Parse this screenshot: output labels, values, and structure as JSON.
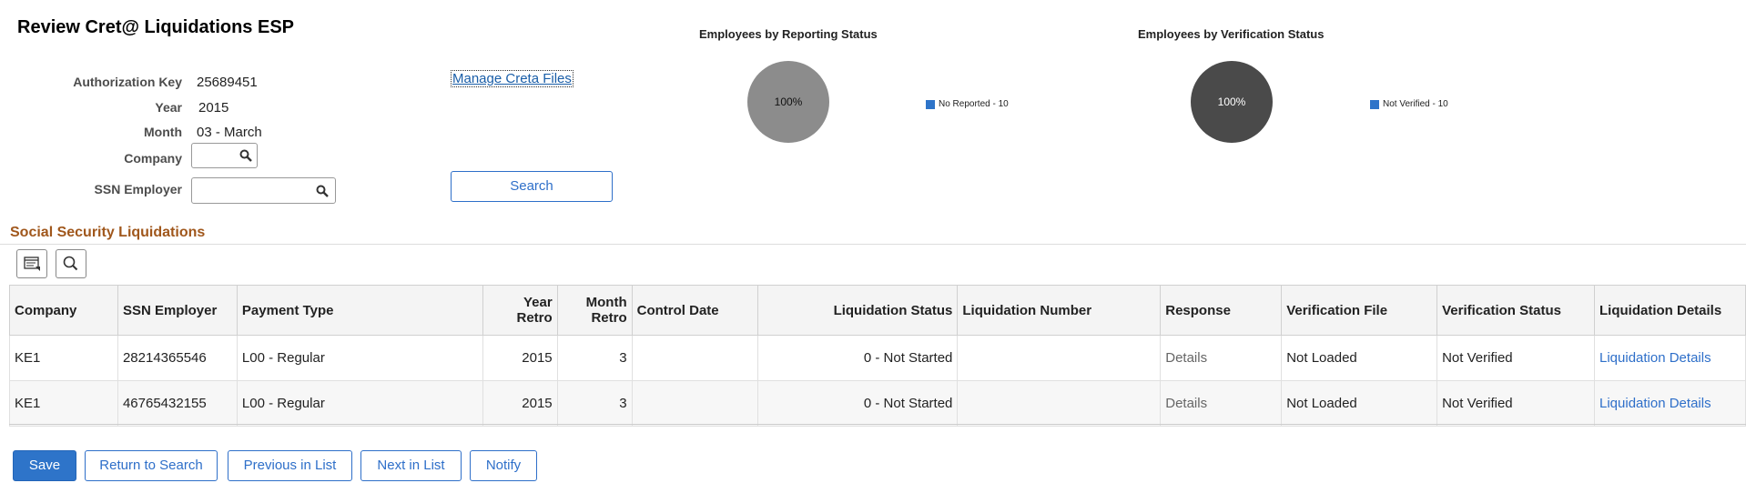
{
  "page": {
    "title": "Review Cret@ Liquidations ESP"
  },
  "form": {
    "authorization_key": {
      "label": "Authorization Key",
      "value": "25689451"
    },
    "year": {
      "label": "Year",
      "value": "2015"
    },
    "month": {
      "label": "Month",
      "value": "03 - March"
    },
    "company": {
      "label": "Company",
      "value": ""
    },
    "ssn_employer": {
      "label": "SSN Employer",
      "value": ""
    },
    "manage_link": "Manage Creta Files",
    "search_button": "Search"
  },
  "charts": {
    "reporting": {
      "title": "Employees by Reporting Status",
      "slice_label": "100%",
      "legend": "No Reported - 10",
      "slice_color": "#8c8c8c",
      "legend_color": "#2e74c9"
    },
    "verification": {
      "title": "Employees by Verification Status",
      "slice_label": "100%",
      "legend": "Not Verified - 10",
      "slice_color": "#4a4a4a",
      "legend_color": "#2e74c9"
    }
  },
  "chart_data": [
    {
      "type": "pie",
      "title": "Employees by Reporting Status",
      "categories": [
        "No Reported"
      ],
      "values": [
        10
      ],
      "labels": [
        "100%"
      ]
    },
    {
      "type": "pie",
      "title": "Employees by Verification Status",
      "categories": [
        "Not Verified"
      ],
      "values": [
        10
      ],
      "labels": [
        "100%"
      ]
    }
  ],
  "grid": {
    "section_title": "Social Security Liquidations",
    "toolbar": {
      "personalize_icon": "grid-settings-icon",
      "find_icon": "search-icon"
    },
    "headers": {
      "company": "Company",
      "ssn_employer": "SSN Employer",
      "payment_type": "Payment Type",
      "year_retro": "Year Retro",
      "month_retro": "Month Retro",
      "control_date": "Control Date",
      "liquidation_status": "Liquidation Status",
      "liquidation_number": "Liquidation Number",
      "response": "Response",
      "verification_file": "Verification File",
      "verification_status": "Verification Status",
      "liquidation_details": "Liquidation Details"
    },
    "rows": [
      {
        "company": "KE1",
        "ssn_employer": "28214365546",
        "payment_type": "L00 - Regular",
        "year_retro": "2015",
        "month_retro": "3",
        "control_date": "",
        "liquidation_status": "0 - Not Started",
        "liquidation_number": "",
        "response": "Details",
        "verification_file": "Not Loaded",
        "verification_status": "Not Verified",
        "liquidation_details": "Liquidation Details"
      },
      {
        "company": "KE1",
        "ssn_employer": "46765432155",
        "payment_type": "L00 - Regular",
        "year_retro": "2015",
        "month_retro": "3",
        "control_date": "",
        "liquidation_status": "0 - Not Started",
        "liquidation_number": "",
        "response": "Details",
        "verification_file": "Not Loaded",
        "verification_status": "Not Verified",
        "liquidation_details": "Liquidation Details"
      }
    ]
  },
  "footer": {
    "save": "Save",
    "return_to_search": "Return to Search",
    "previous_in_list": "Previous in List",
    "next_in_list": "Next in List",
    "notify": "Notify"
  }
}
